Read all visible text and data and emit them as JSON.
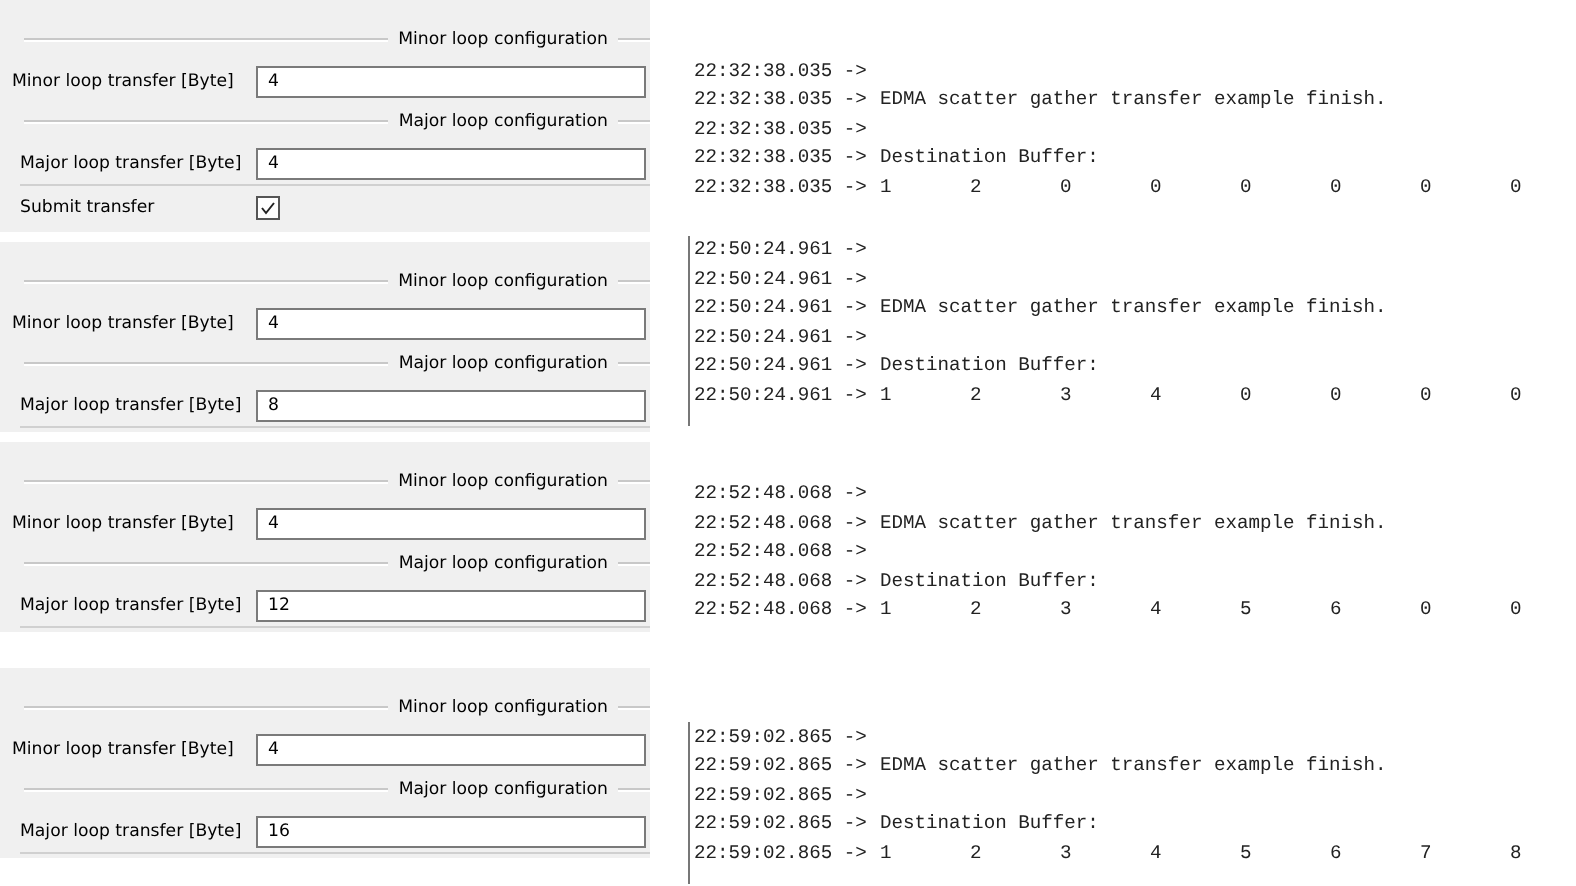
{
  "config_panels": [
    {
      "items": [
        {
          "kind": "heading",
          "title": "Minor loop configuration"
        },
        {
          "kind": "field",
          "label": "Minor loop transfer [Byte]",
          "value": "4"
        },
        {
          "kind": "heading",
          "title": "Major loop configuration"
        },
        {
          "kind": "field",
          "label": "Major loop transfer [Byte]",
          "value": "4"
        },
        {
          "kind": "checkbox",
          "label": "Submit transfer",
          "checked": true
        }
      ]
    },
    {
      "items": [
        {
          "kind": "heading",
          "title": "Minor loop configuration"
        },
        {
          "kind": "field",
          "label": "Minor loop transfer [Byte]",
          "value": "4"
        },
        {
          "kind": "heading",
          "title": "Major loop configuration"
        },
        {
          "kind": "field",
          "label": "Major loop transfer [Byte]",
          "value": "8"
        }
      ]
    },
    {
      "items": [
        {
          "kind": "heading",
          "title": "Minor loop configuration"
        },
        {
          "kind": "field",
          "label": "Minor loop transfer [Byte]",
          "value": "4"
        },
        {
          "kind": "heading",
          "title": "Major loop configuration"
        },
        {
          "kind": "field",
          "label": "Major loop transfer [Byte]",
          "value": "12"
        }
      ]
    },
    {
      "items": [
        {
          "kind": "heading",
          "title": "Minor loop configuration"
        },
        {
          "kind": "field",
          "label": "Minor loop transfer [Byte]",
          "value": "4"
        },
        {
          "kind": "heading",
          "title": "Major loop configuration"
        },
        {
          "kind": "field",
          "label": "Major loop transfer [Byte]",
          "value": "16"
        }
      ]
    }
  ],
  "logs": [
    {
      "lines": [
        {
          "time": "22:32:38.035 ->"
        },
        {
          "time": "22:32:38.035 ->",
          "text": "EDMA scatter gather transfer example finish."
        },
        {
          "time": "22:32:38.035 ->"
        },
        {
          "time": "22:32:38.035 ->",
          "text": "Destination Buffer:"
        },
        {
          "time": "22:32:38.035 ->",
          "values": [
            "1",
            "2",
            "0",
            "0",
            "0",
            "0",
            "0",
            "0"
          ]
        }
      ]
    },
    {
      "lines": [
        {
          "time": "22:50:24.961 ->"
        },
        {
          "time": "22:50:24.961 ->"
        },
        {
          "time": "22:50:24.961 ->",
          "text": "EDMA scatter gather transfer example finish."
        },
        {
          "time": "22:50:24.961 ->"
        },
        {
          "time": "22:50:24.961 ->",
          "text": "Destination Buffer:"
        },
        {
          "time": "22:50:24.961 ->",
          "values": [
            "1",
            "2",
            "3",
            "4",
            "0",
            "0",
            "0",
            "0"
          ]
        }
      ]
    },
    {
      "lines": [
        {
          "time": "22:52:48.068 ->"
        },
        {
          "time": "22:52:48.068 ->",
          "text": "EDMA scatter gather transfer example finish."
        },
        {
          "time": "22:52:48.068 ->"
        },
        {
          "time": "22:52:48.068 ->",
          "text": "Destination Buffer:"
        },
        {
          "time": "22:52:48.068 ->",
          "values": [
            "1",
            "2",
            "3",
            "4",
            "5",
            "6",
            "0",
            "0"
          ]
        }
      ]
    },
    {
      "lines": [
        {
          "time": "22:59:02.865 ->"
        },
        {
          "time": "22:59:02.865 ->",
          "text": "EDMA scatter gather transfer example finish."
        },
        {
          "time": "22:59:02.865 ->"
        },
        {
          "time": "22:59:02.865 ->",
          "text": "Destination Buffer:"
        },
        {
          "time": "22:59:02.865 ->",
          "values": [
            "1",
            "2",
            "3",
            "4",
            "5",
            "6",
            "7",
            "8"
          ]
        }
      ]
    }
  ]
}
